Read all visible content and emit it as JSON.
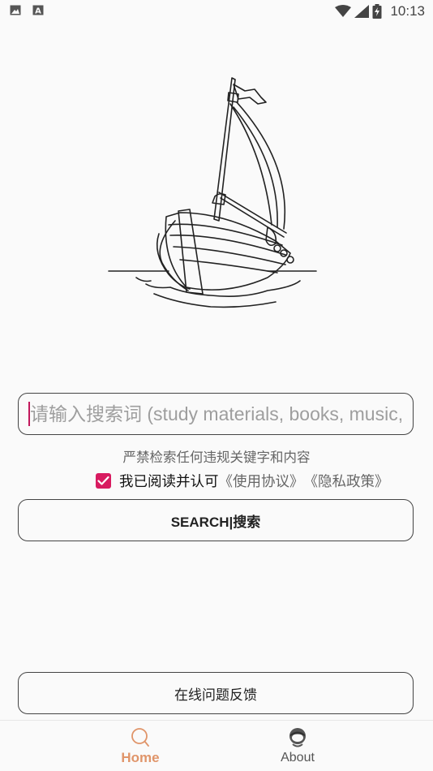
{
  "status_bar": {
    "time": "10:13",
    "left_icons": [
      "image-icon",
      "text-a-icon"
    ],
    "right_icons": [
      "wifi-icon",
      "signal-icon",
      "battery-icon"
    ]
  },
  "illustration": {
    "icon": "sailboat-illustration"
  },
  "search": {
    "placeholder": "请输入搜索词 (study materials, books, music,",
    "value": ""
  },
  "notice": {
    "text": "严禁检索任何违规关键字和内容"
  },
  "agreement": {
    "checked": true,
    "label": "我已阅读并认可",
    "terms_link": "《使用协议》",
    "privacy_link": "《隐私政策》"
  },
  "buttons": {
    "search_label": "SEARCH|搜索",
    "feedback_label": "在线问题反馈"
  },
  "bottom_nav": {
    "items": [
      {
        "label": "Home",
        "icon": "search-icon",
        "active": true
      },
      {
        "label": "About",
        "icon": "avatar-icon",
        "active": false
      }
    ]
  },
  "colors": {
    "accent": "#d81b60",
    "nav_active": "#e0956a",
    "border": "#444444"
  }
}
